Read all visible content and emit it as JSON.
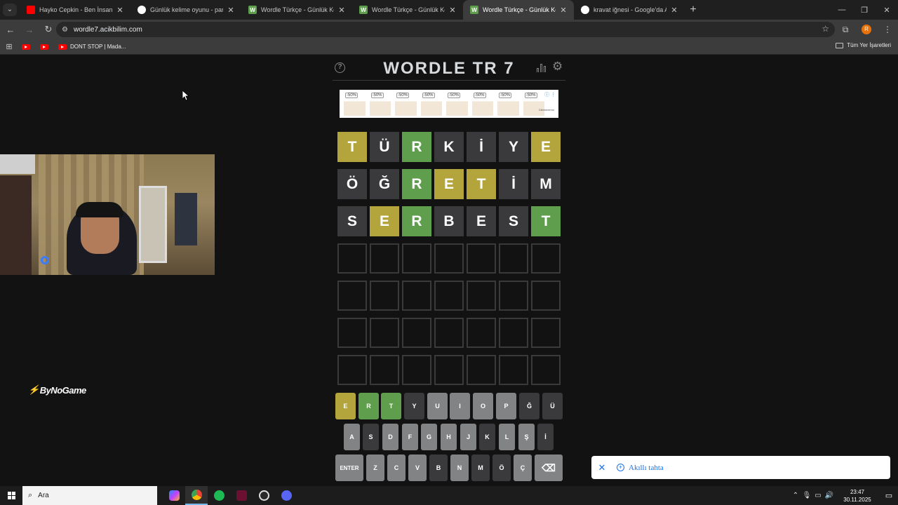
{
  "browser": {
    "tabs": [
      {
        "title": "Hayko Cepkin - Ben İnsan Değ",
        "favicon": "youtube-icon",
        "color": "#ff0000",
        "active": false
      },
      {
        "title": "Günlük kelime oyunu - parolla",
        "favicon": "parolla-icon",
        "color": "#ffffff",
        "active": false
      },
      {
        "title": "Wordle Türkçe - Günlük Kelime",
        "favicon": "wordle-icon",
        "color": "#5e9e4c",
        "active": false
      },
      {
        "title": "Wordle Türkçe - Günlük Kelime",
        "favicon": "wordle-icon",
        "color": "#5e9e4c",
        "active": false
      },
      {
        "title": "Wordle Türkçe - Günlük Kelime",
        "favicon": "wordle-icon",
        "color": "#5e9e4c",
        "active": true
      },
      {
        "title": "kravat iğnesi - Google'da Ara",
        "favicon": "google-icon",
        "color": "#ffffff",
        "active": false
      }
    ],
    "url": "wordle7.acikbilim.com",
    "bookmarks": [
      {
        "label": "",
        "icon": "youtube-icon"
      },
      {
        "label": "",
        "icon": "youtube-icon"
      },
      {
        "label": "DONT STOP | Mada...",
        "icon": "youtube-icon"
      }
    ],
    "all_bookmarks_label": "Tüm Yer İşaretleri",
    "profile_initial": "R"
  },
  "game": {
    "title": "WORDLE TR 7",
    "ad": {
      "badges": [
        "-50%",
        "-50%",
        "-50%",
        "-50%",
        "-50%",
        "-50%",
        "-50%",
        "-50%"
      ],
      "brand": "Cilekseremo"
    },
    "board": [
      [
        {
          "l": "T",
          "s": "present"
        },
        {
          "l": "Ü",
          "s": "absent"
        },
        {
          "l": "R",
          "s": "correct"
        },
        {
          "l": "K",
          "s": "absent"
        },
        {
          "l": "İ",
          "s": "absent"
        },
        {
          "l": "Y",
          "s": "absent"
        },
        {
          "l": "E",
          "s": "present"
        }
      ],
      [
        {
          "l": "Ö",
          "s": "absent"
        },
        {
          "l": "Ğ",
          "s": "absent"
        },
        {
          "l": "R",
          "s": "correct"
        },
        {
          "l": "E",
          "s": "present"
        },
        {
          "l": "T",
          "s": "present"
        },
        {
          "l": "İ",
          "s": "absent"
        },
        {
          "l": "M",
          "s": "absent"
        }
      ],
      [
        {
          "l": "S",
          "s": "absent"
        },
        {
          "l": "E",
          "s": "present"
        },
        {
          "l": "R",
          "s": "correct"
        },
        {
          "l": "B",
          "s": "absent"
        },
        {
          "l": "E",
          "s": "absent"
        },
        {
          "l": "S",
          "s": "absent"
        },
        {
          "l": "T",
          "s": "correct"
        }
      ],
      [
        {
          "l": "",
          "s": "empty"
        },
        {
          "l": "",
          "s": "empty"
        },
        {
          "l": "",
          "s": "empty"
        },
        {
          "l": "",
          "s": "empty"
        },
        {
          "l": "",
          "s": "empty"
        },
        {
          "l": "",
          "s": "empty"
        },
        {
          "l": "",
          "s": "empty"
        }
      ],
      [
        {
          "l": "",
          "s": "empty"
        },
        {
          "l": "",
          "s": "empty"
        },
        {
          "l": "",
          "s": "empty"
        },
        {
          "l": "",
          "s": "empty"
        },
        {
          "l": "",
          "s": "empty"
        },
        {
          "l": "",
          "s": "empty"
        },
        {
          "l": "",
          "s": "empty"
        }
      ],
      [
        {
          "l": "",
          "s": "empty"
        },
        {
          "l": "",
          "s": "empty"
        },
        {
          "l": "",
          "s": "empty"
        },
        {
          "l": "",
          "s": "empty"
        },
        {
          "l": "",
          "s": "empty"
        },
        {
          "l": "",
          "s": "empty"
        },
        {
          "l": "",
          "s": "empty"
        }
      ],
      [
        {
          "l": "",
          "s": "empty"
        },
        {
          "l": "",
          "s": "empty"
        },
        {
          "l": "",
          "s": "empty"
        },
        {
          "l": "",
          "s": "empty"
        },
        {
          "l": "",
          "s": "empty"
        },
        {
          "l": "",
          "s": "empty"
        },
        {
          "l": "",
          "s": "empty"
        }
      ]
    ],
    "keyboard": [
      [
        {
          "k": "E",
          "s": "present"
        },
        {
          "k": "R",
          "s": "correct"
        },
        {
          "k": "T",
          "s": "correct"
        },
        {
          "k": "Y",
          "s": "absent"
        },
        {
          "k": "U",
          "s": "unused"
        },
        {
          "k": "I",
          "s": "unused"
        },
        {
          "k": "O",
          "s": "unused"
        },
        {
          "k": "P",
          "s": "unused"
        },
        {
          "k": "Ğ",
          "s": "absent"
        },
        {
          "k": "Ü",
          "s": "absent"
        }
      ],
      [
        {
          "k": "A",
          "s": "unused"
        },
        {
          "k": "S",
          "s": "absent"
        },
        {
          "k": "D",
          "s": "unused"
        },
        {
          "k": "F",
          "s": "unused"
        },
        {
          "k": "G",
          "s": "unused"
        },
        {
          "k": "H",
          "s": "unused"
        },
        {
          "k": "J",
          "s": "unused"
        },
        {
          "k": "K",
          "s": "absent"
        },
        {
          "k": "L",
          "s": "unused"
        },
        {
          "k": "Ş",
          "s": "unused"
        },
        {
          "k": "İ",
          "s": "absent"
        }
      ],
      [
        {
          "k": "ENTER",
          "s": "unused"
        },
        {
          "k": "Z",
          "s": "unused"
        },
        {
          "k": "C",
          "s": "unused"
        },
        {
          "k": "V",
          "s": "unused"
        },
        {
          "k": "B",
          "s": "absent"
        },
        {
          "k": "N",
          "s": "unused"
        },
        {
          "k": "M",
          "s": "absent"
        },
        {
          "k": "Ö",
          "s": "absent"
        },
        {
          "k": "Ç",
          "s": "unused"
        },
        {
          "k": "⌫",
          "s": "unused"
        }
      ]
    ]
  },
  "overlay": {
    "brand": "ByNoGame",
    "toast_label": "Akıllı tahta"
  },
  "colors": {
    "correct": "#5e9e4c",
    "present": "#b4a43c",
    "absent": "#3a3a3c",
    "unused": "#818384"
  },
  "taskbar": {
    "search_placeholder": "Ara",
    "time": "23:47",
    "date": "30.11.2025"
  }
}
